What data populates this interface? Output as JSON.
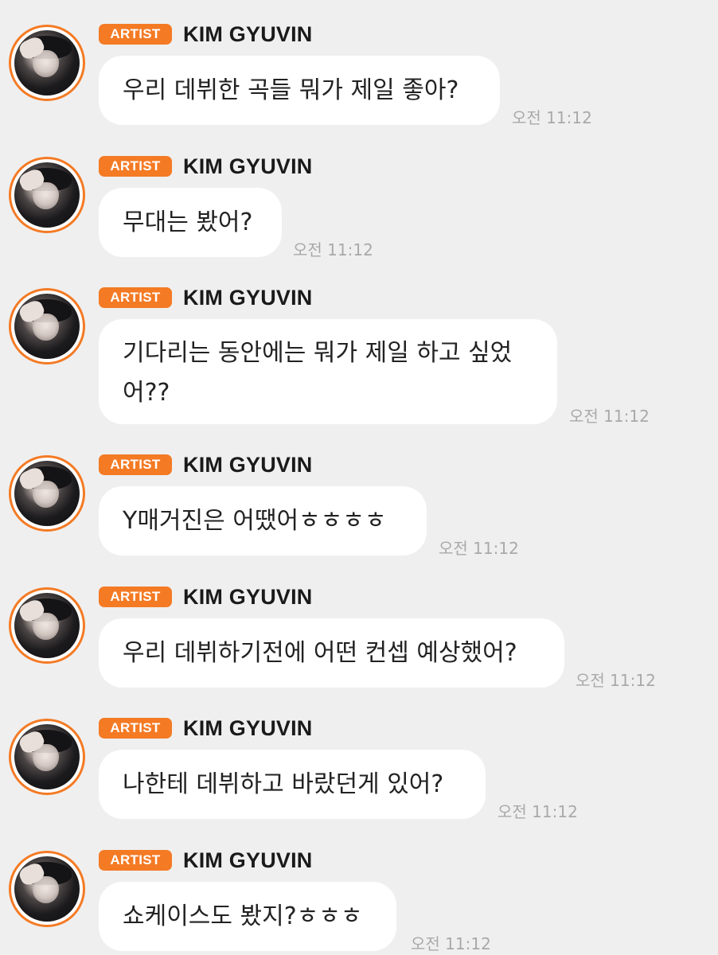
{
  "badge_label": "ARTIST",
  "colors": {
    "accent": "#f47a24",
    "background": "#efefef",
    "bubble": "#ffffff",
    "timestamp": "#a9a9a9"
  },
  "messages": [
    {
      "sender": "KIM GYUVIN",
      "text": "우리 데뷔한 곡들 뭐가 제일 좋아?",
      "time": "오전 11:12"
    },
    {
      "sender": "KIM GYUVIN",
      "text": "무대는 봤어?",
      "time": "오전 11:12"
    },
    {
      "sender": "KIM GYUVIN",
      "text": "기다리는 동안에는 뭐가 제일 하고 싶었어??",
      "time": "오전 11:12"
    },
    {
      "sender": "KIM GYUVIN",
      "text": "Y매거진은 어땠어ㅎㅎㅎㅎ",
      "time": "오전 11:12"
    },
    {
      "sender": "KIM GYUVIN",
      "text": "우리 데뷔하기전에 어떤 컨셉 예상했어?",
      "time": "오전 11:12"
    },
    {
      "sender": "KIM GYUVIN",
      "text": "나한테 데뷔하고 바랐던게 있어?",
      "time": "오전 11:12"
    },
    {
      "sender": "KIM GYUVIN",
      "text": "쇼케이스도 봤지?ㅎㅎㅎ",
      "time": "오전 11:12"
    }
  ]
}
